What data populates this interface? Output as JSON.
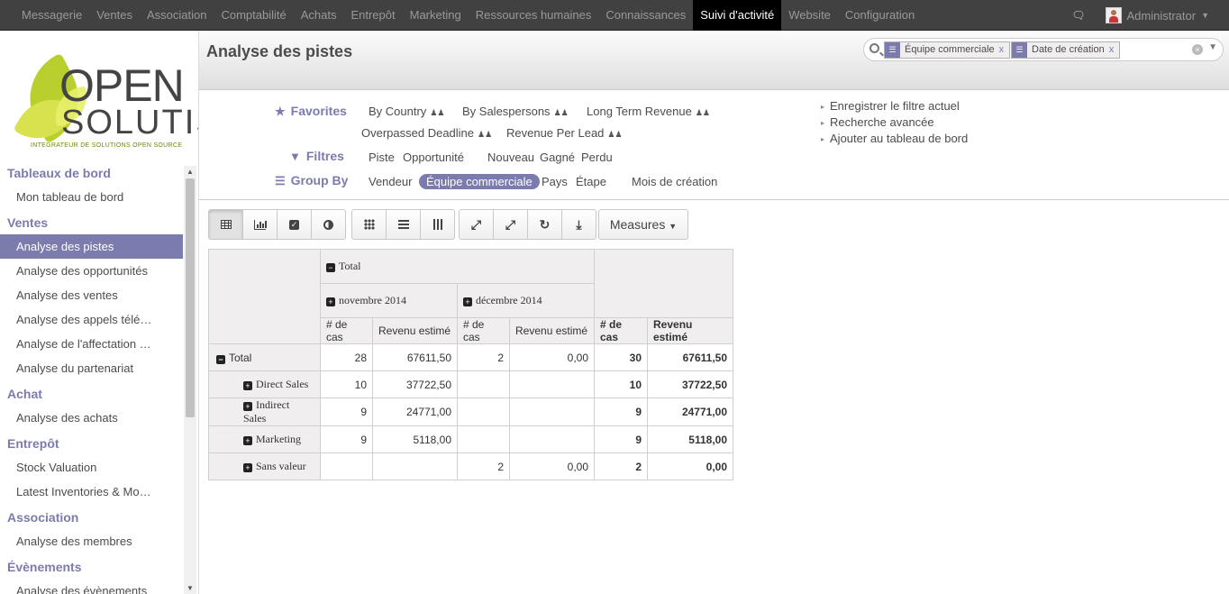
{
  "topbar": {
    "menu": [
      "Messagerie",
      "Ventes",
      "Association",
      "Comptabilité",
      "Achats",
      "Entrepôt",
      "Marketing",
      "Ressources humaines",
      "Connaissances",
      "Suivi d'activité",
      "Website",
      "Configuration"
    ],
    "active_index": 9,
    "user": "Administrator",
    "chat_icon": "chat-bubbles-icon"
  },
  "logo": {
    "line1": "OPEN",
    "line2": "SOLUTIS",
    "tagline": "INTEGRATEUR DE SOLUTIONS OPEN SOURCE"
  },
  "sidebar": {
    "sections": [
      {
        "title": "Tableaux de bord",
        "items": [
          "Mon tableau de bord"
        ]
      },
      {
        "title": "Ventes",
        "items": [
          "Analyse des pistes",
          "Analyse des opportunités",
          "Analyse des ventes",
          "Analyse des appels télé…",
          "Analyse de l'affectation …",
          "Analyse du partenariat"
        ]
      },
      {
        "title": "Achat",
        "items": [
          "Analyse des achats"
        ]
      },
      {
        "title": "Entrepôt",
        "items": [
          "Stock Valuation",
          "Latest Inventories & Mo…"
        ]
      },
      {
        "title": "Association",
        "items": [
          "Analyse des membres"
        ]
      },
      {
        "title": "Évènements",
        "items": [
          "Analyse des évènements"
        ]
      }
    ],
    "active_item": "Analyse des pistes"
  },
  "header": {
    "title": "Analyse des pistes",
    "facets": [
      {
        "label": "Équipe commerciale",
        "remove": "x"
      },
      {
        "label": "Date de création",
        "remove": "x"
      }
    ]
  },
  "filters": {
    "favorites_title": "Favorites",
    "favorites": [
      "By Country",
      "By Salespersons",
      "Long Term Revenue",
      "Overpassed Deadline",
      "Revenue Per Lead"
    ],
    "filters_title": "Filtres",
    "filters": [
      "Piste",
      "Opportunité",
      "Nouveau",
      "Gagné",
      "Perdu"
    ],
    "groupby_title": "Group By",
    "groupby": [
      "Vendeur",
      "Équipe commerciale",
      "Pays",
      "Étape",
      "Mois de création"
    ],
    "groupby_selected": "Équipe commerciale",
    "links": [
      "Enregistrer le filtre actuel",
      "Recherche avancée",
      "Ajouter au tableau de bord"
    ]
  },
  "toolbar": {
    "measures_label": "Measures"
  },
  "pivot": {
    "col_total": "Total",
    "months": [
      "novembre 2014",
      "décembre 2014"
    ],
    "measures": [
      "# de cas",
      "Revenu estimé"
    ],
    "rows": [
      {
        "label": "Total",
        "expand": "minus",
        "v": [
          "28",
          "67611,50",
          "2",
          "0,00",
          "30",
          "67611,50"
        ]
      },
      {
        "label": "Direct Sales",
        "expand": "plus",
        "v": [
          "10",
          "37722,50",
          "",
          "",
          "10",
          "37722,50"
        ]
      },
      {
        "label": "Indirect Sales",
        "expand": "plus",
        "v": [
          "9",
          "24771,00",
          "",
          "",
          "9",
          "24771,00"
        ]
      },
      {
        "label": "Marketing",
        "expand": "plus",
        "v": [
          "9",
          "5118,00",
          "",
          "",
          "9",
          "5118,00"
        ]
      },
      {
        "label": "Sans valeur",
        "expand": "plus",
        "v": [
          "",
          "",
          "2",
          "0,00",
          "2",
          "0,00"
        ]
      }
    ]
  }
}
